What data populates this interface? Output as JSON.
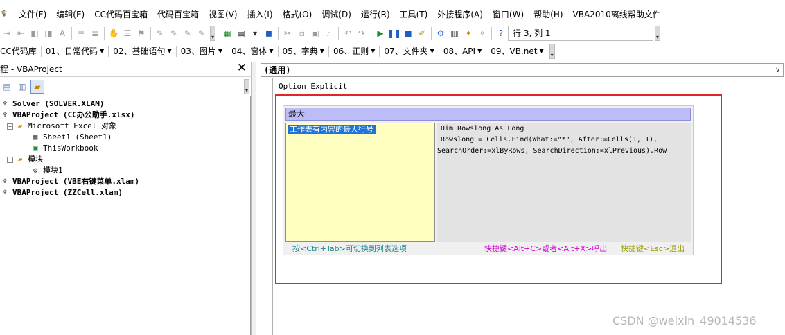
{
  "menu": {
    "items": [
      "文件(F)",
      "编辑(E)",
      "CC代码百宝箱",
      "代码百宝箱",
      "视图(V)",
      "插入(I)",
      "格式(O)",
      "调试(D)",
      "运行(R)",
      "工具(T)",
      "外接程序(A)",
      "窗口(W)",
      "帮助(H)",
      "VBA2010离线帮助文件"
    ]
  },
  "toolbar": {
    "status": "行 3, 列 1"
  },
  "addin_toolbar": {
    "items": [
      "CC代码库",
      "01、日常代码",
      "02、基础语句",
      "03、图片",
      "04、窗体",
      "05、字典",
      "06、正则",
      "07、文件夹",
      "08、API",
      "09、VB.net"
    ]
  },
  "project": {
    "title": "程 - VBAProject",
    "close": "✕",
    "tree": [
      "Solver (SOLVER.XLAM)",
      "VBAProject (CC办公助手.xlsx)",
      "Microsoft Excel 对象",
      "Sheet1 (Sheet1)",
      "ThisWorkbook",
      "模块",
      "模块1",
      "VBAProject (VBE右键菜单.xlam)",
      "VBAProject (ZZCell.xlam)"
    ]
  },
  "code": {
    "combo": "(通用)",
    "line1": "Option Explicit"
  },
  "popup": {
    "search": "最大",
    "selected_item": "工作表有内容的最大行号",
    "code_lines": [
      " Dim Rowslong As Long",
      " Rowslong = Cells.Find(What:=\"*\", After:=Cells(1, 1),",
      "SearchOrder:=xlByRows, SearchDirection:=xlPrevious).Row"
    ],
    "hint_left": "按<Ctrl+Tab>可切换到列表选项",
    "hint_mid": "快捷键<Alt+C>或者<Alt+X>呼出",
    "hint_right": "快捷键<Esc>退出"
  },
  "watermark": "CSDN @weixin_49014536"
}
